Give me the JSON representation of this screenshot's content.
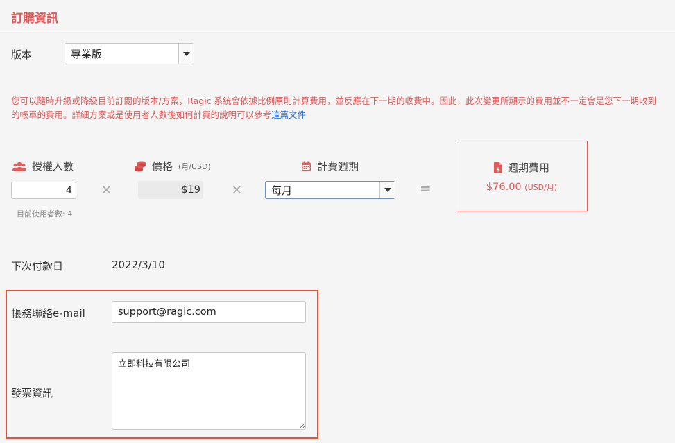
{
  "section_title": "訂購資訊",
  "version": {
    "label": "版本",
    "selected": "專業版"
  },
  "notice": {
    "text": "您可以隨時升級或降級目前訂閱的版本/方案，Ragic 系統會依據比例原則計算費用，並反應在下一期的收費中。因此，此次變更所顯示的費用並不一定會是您下一期收到的帳單的費用。詳細方案或是使用者人數後如何計費的說明可以參考",
    "link_text": "這篇文件"
  },
  "calc": {
    "users_label": "授權人數",
    "users_value": "4",
    "current_users_note": "目前使用者數: 4",
    "times_symbol": "×",
    "price_label": "價格",
    "price_unit": "(月/USD)",
    "price_value": "$19",
    "cycle_label": "計費週期",
    "cycle_selected": "每月",
    "equals_symbol": "=",
    "total_label": "週期費用",
    "total_value": "$76.00",
    "total_unit": "(USD/月)"
  },
  "next_payment": {
    "label": "下次付款日",
    "value": "2022/3/10"
  },
  "billing": {
    "email_label": "帳務聯絡e-mail",
    "email_value": "support@ragic.com",
    "invoice_label": "發票資訊",
    "invoice_value": "立即科技有限公司"
  },
  "colors": {
    "accent": "#e05a5a",
    "highlight_border": "#e5533d",
    "link": "#2b6fd6"
  },
  "icons": {
    "users": "users-icon",
    "price": "coins-icon",
    "cycle": "calendar-icon",
    "total": "invoice-dollar-icon"
  }
}
